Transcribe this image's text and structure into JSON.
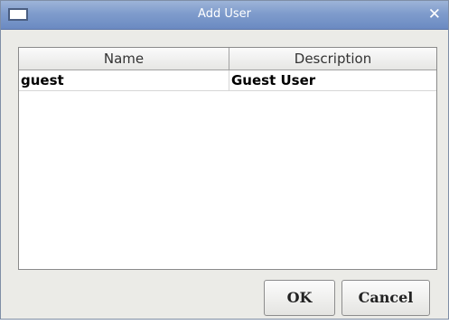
{
  "window": {
    "title": "Add User",
    "close_symbol": "✕",
    "icons": [
      "window-icon",
      "close-icon"
    ]
  },
  "table": {
    "columns": [
      "Name",
      "Description"
    ],
    "rows": [
      {
        "name": "guest",
        "description": "Guest User"
      }
    ]
  },
  "buttons": {
    "ok_label": "OK",
    "cancel_label": "Cancel"
  },
  "colors": {
    "titlebar": "#7f9ccc",
    "dialog_background": "#ebebe7"
  }
}
